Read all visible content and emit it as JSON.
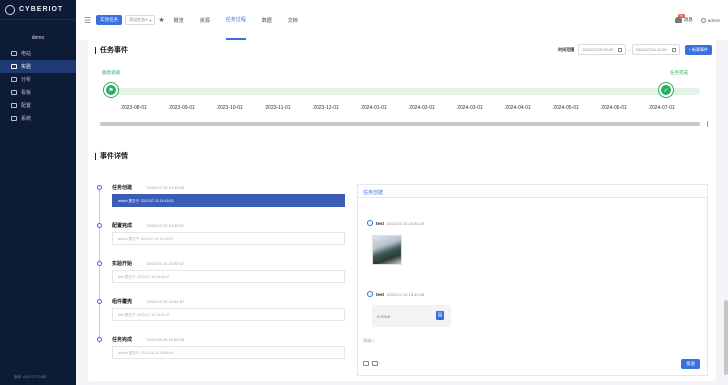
{
  "sidebar": {
    "logo": "CYBERIOT",
    "project": "demo",
    "items": [
      {
        "label": "电站",
        "icon": "station-icon",
        "active": false
      },
      {
        "label": "实验",
        "icon": "experiment-icon",
        "active": true
      },
      {
        "label": "分析",
        "icon": "analysis-icon",
        "active": false
      },
      {
        "label": "看板",
        "icon": "dashboard-icon",
        "active": false
      },
      {
        "label": "配置",
        "icon": "config-icon",
        "active": false
      },
      {
        "label": "系统",
        "icon": "system-icon",
        "active": false
      }
    ],
    "version": "版本: v25.0727.0130"
  },
  "header": {
    "experiment_button": "实验任务",
    "select_placeholder": "测试任务3",
    "tabs": [
      {
        "label": "概览",
        "active": false
      },
      {
        "label": "资源",
        "active": false
      },
      {
        "label": "任务过程",
        "active": true
      },
      {
        "label": "数据",
        "active": false
      },
      {
        "label": "文档",
        "active": false
      }
    ],
    "messages_label": "消息",
    "message_count": "99",
    "user": "admin"
  },
  "task_events": {
    "title": "任务事件",
    "time_label": "时间范围",
    "start_time": "2023/07/10 00:00",
    "end_time": "2024/07/24 11:00",
    "range_dash": "-",
    "new_button": "+ 新建事件",
    "start_label": "随意调速",
    "end_label": "任务完成",
    "dates": [
      "2023-08-01",
      "2023-09-01",
      "2023-10-01",
      "2023-11-01",
      "2023-12-01",
      "2024-01-01",
      "2024-02-01",
      "2024-03-01",
      "2024-04-01",
      "2024-05-01",
      "2024-06-01",
      "2024-07-01"
    ]
  },
  "event_details": {
    "title": "事件详情",
    "events": [
      {
        "title": "任务创建",
        "time": "2023-07-10 14:15:03",
        "note": "admin  提交于: 2023-07-10 14:15:03",
        "active": true
      },
      {
        "title": "配置完成",
        "time": "2023-07-10 14:15:07",
        "note": "admin  提交于: 2023-07-10 14:15:07",
        "active": false
      },
      {
        "title": "实验开始",
        "time": "2023-07-10 15:30:47",
        "note": "test  提交于: 2023-07-10 15:30:47",
        "active": false
      },
      {
        "title": "组件覆壳",
        "time": "2023-07-10 15:31:07",
        "note": "test  提交于: 2023-07-10 15:31:07",
        "active": false
      },
      {
        "title": "任务完成",
        "time": "2024-06-25 15:55:44",
        "note": "admin  提交于: 2024-06-25 15:55:44",
        "active": false
      }
    ],
    "panel": {
      "title": "任务创建",
      "msg1_user": "test",
      "msg1_time": "2023-07-10 15:31:20",
      "msg2_user": "test",
      "msg2_time": "2023-07-10 15:42:45",
      "file_size": "0.00KB",
      "input_placeholder": "请输入",
      "send_button": "发送"
    }
  }
}
